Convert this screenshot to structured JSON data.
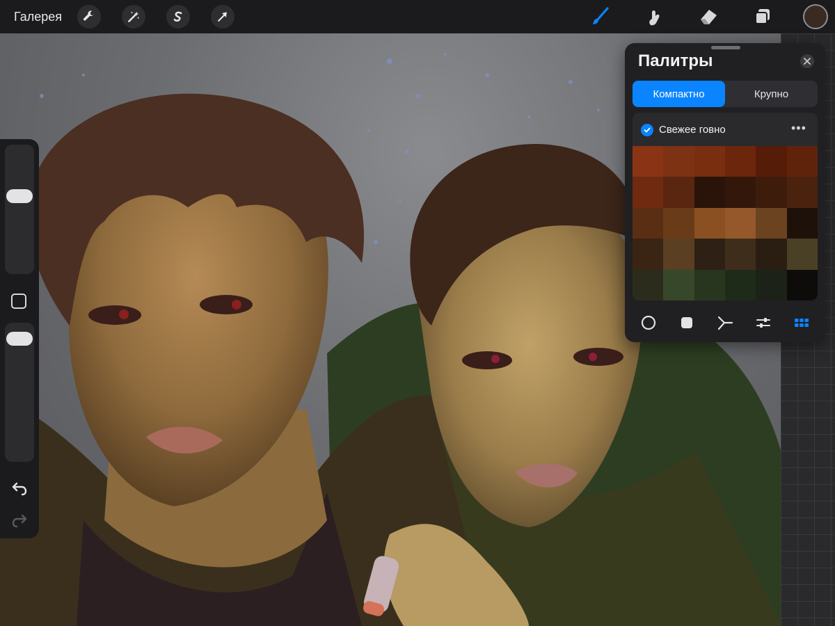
{
  "topbar": {
    "gallery_label": "Галерея",
    "left_tools": [
      "wrench-icon",
      "magic-wand-icon",
      "selection-s-icon",
      "arrow-transform-icon"
    ],
    "right_tools": [
      "brush-icon",
      "smudge-icon",
      "eraser-icon",
      "layers-icon"
    ],
    "current_color": "#3a2b22",
    "active_tool_color": "#0a84ff"
  },
  "sidebar": {
    "brush_size_level": 0.62,
    "opacity_level": 0.95
  },
  "palettes": {
    "title": "Палитры",
    "tabs": [
      "Компактно",
      "Крупно"
    ],
    "active_tab": 0,
    "palette": {
      "name": "Свежее говно",
      "checked": true,
      "more_label": "•••",
      "colors": [
        "#8a3415",
        "#7d3214",
        "#7a2e10",
        "#6c260c",
        "#551c08",
        "#5f230b",
        "#6f2a10",
        "#5a2610",
        "#2a1409",
        "#33170b",
        "#3e1c0b",
        "#4b220d",
        "#5a2e12",
        "#6a3b18",
        "#8a5022",
        "#94582a",
        "#6b4320",
        "#1d110a",
        "#3a2413",
        "#5a3f22",
        "#2e2014",
        "#3f2d1c",
        "#2a1e12",
        "#4a4026",
        "#2c2c1c",
        "#36472a",
        "#28361f",
        "#1e2b19",
        "#1c2217",
        "#0e0c0a"
      ]
    },
    "bottom_tabs": [
      "disc-icon",
      "square-icon",
      "harmony-icon",
      "sliders-icon",
      "palette-grid-icon"
    ],
    "active_bottom_tab": 4
  }
}
